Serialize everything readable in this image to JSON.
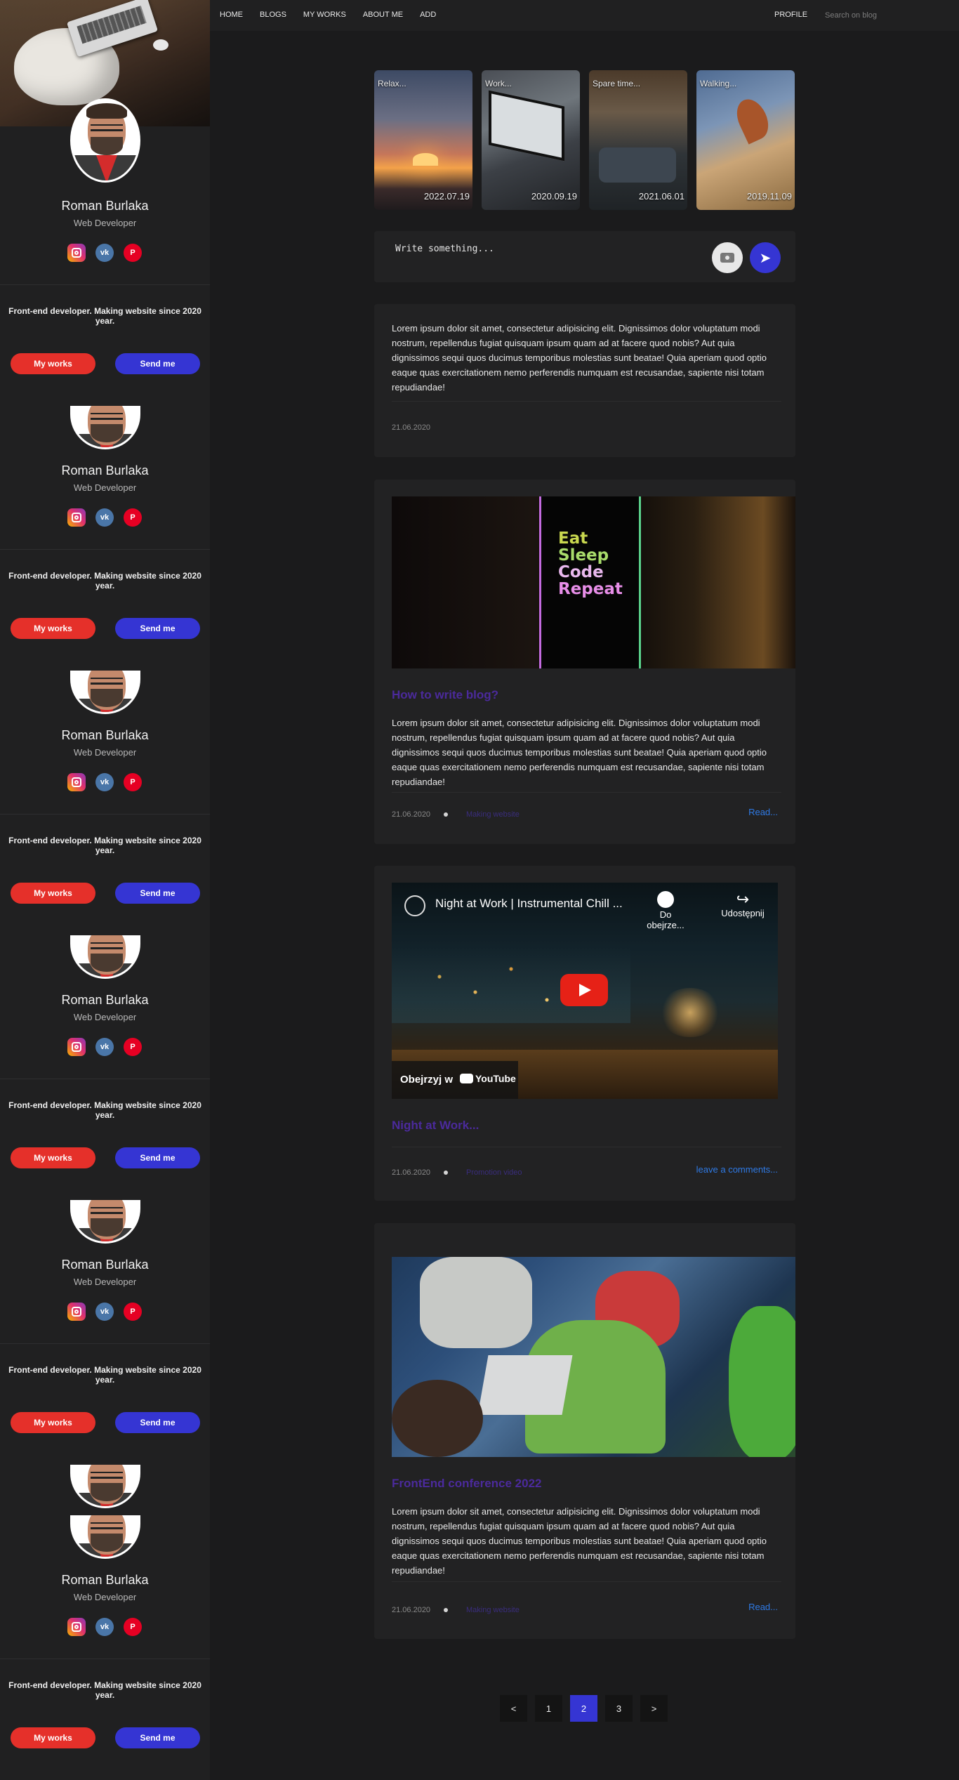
{
  "nav": {
    "links": [
      "HOME",
      "BLOGS",
      "MY WORKS",
      "ABOUT ME",
      "ADD"
    ],
    "profile": "PROFILE",
    "search_placeholder": "Search on blog"
  },
  "profile": {
    "name": "Roman Burlaka",
    "role": "Web Developer",
    "tagline": "Front-end developer. Making website since 2020 year.",
    "btn_works": "My works",
    "btn_send": "Send me",
    "socials": [
      "instagram-icon",
      "vk-icon",
      "pinterest-icon"
    ]
  },
  "stories": [
    {
      "label": "Relax...",
      "date": "2022.07.19"
    },
    {
      "label": "Work...",
      "date": "2020.09.19"
    },
    {
      "label": "Spare time...",
      "date": "2021.06.01"
    },
    {
      "label": "Walking...",
      "date": "2019.11.09"
    }
  ],
  "composer": {
    "placeholder": "Write something..."
  },
  "posts": [
    {
      "text": "Lorem ipsum dolor sit amet, consectetur adipisicing elit. Dignissimos dolor voluptatum modi nostrum, repellendus fugiat quisquam ipsum quam ad at facere quod nobis? Aut quia dignissimos sequi quos ducimus temporibus molestias sunt beatae! Quia aperiam quod optio eaque quas exercitationem nemo perferendis numquam est recusandae, sapiente nisi totam repudiandae!",
      "date": "21.06.2020"
    },
    {
      "image_text": [
        "Eat",
        "Sleep",
        "Code",
        "Repeat"
      ],
      "title": "How to write blog?",
      "text": "Lorem ipsum dolor sit amet, consectetur adipisicing elit. Dignissimos dolor voluptatum modi nostrum, repellendus fugiat quisquam ipsum quam ad at facere quod nobis? Aut quia dignissimos sequi quos ducimus temporibus molestias sunt beatae! Quia aperiam quod optio eaque quas exercitationem nemo perferendis numquam est recusandae, sapiente nisi totam repudiandae!",
      "date": "21.06.2020",
      "tag": "Making website",
      "link": "Read..."
    },
    {
      "video_title": "Night at Work | Instrumental Chill ...",
      "video_watch_later": "Do obejrze...",
      "video_share": "Udostępnij",
      "video_watch_on": "Obejrzyj w",
      "video_brand": "YouTube",
      "title": "Night at Work...",
      "date": "21.06.2020",
      "tag": "Promotion video",
      "link": "leave a comments..."
    },
    {
      "title": "FrontEnd conference 2022",
      "text": "Lorem ipsum dolor sit amet, consectetur adipisicing elit. Dignissimos dolor voluptatum modi nostrum, repellendus fugiat quisquam ipsum quam ad at facere quod nobis? Aut quia dignissimos sequi quos ducimus temporibus molestias sunt beatae! Quia aperiam quod optio eaque quas exercitationem nemo perferendis numquam est recusandae, sapiente nisi totam repudiandae!",
      "date": "21.06.2020",
      "tag": "Making website",
      "link": "Read..."
    }
  ],
  "pagination": {
    "prev": "<",
    "pages": [
      "1",
      "2",
      "3"
    ],
    "active": "2",
    "next": ">"
  },
  "colors": {
    "accent_blue": "#3535d3",
    "accent_red": "#e5302a",
    "link": "#2f7ae5",
    "title_purple": "#4b2a9c",
    "bg": "#1b1b1c",
    "panel": "#222223"
  }
}
